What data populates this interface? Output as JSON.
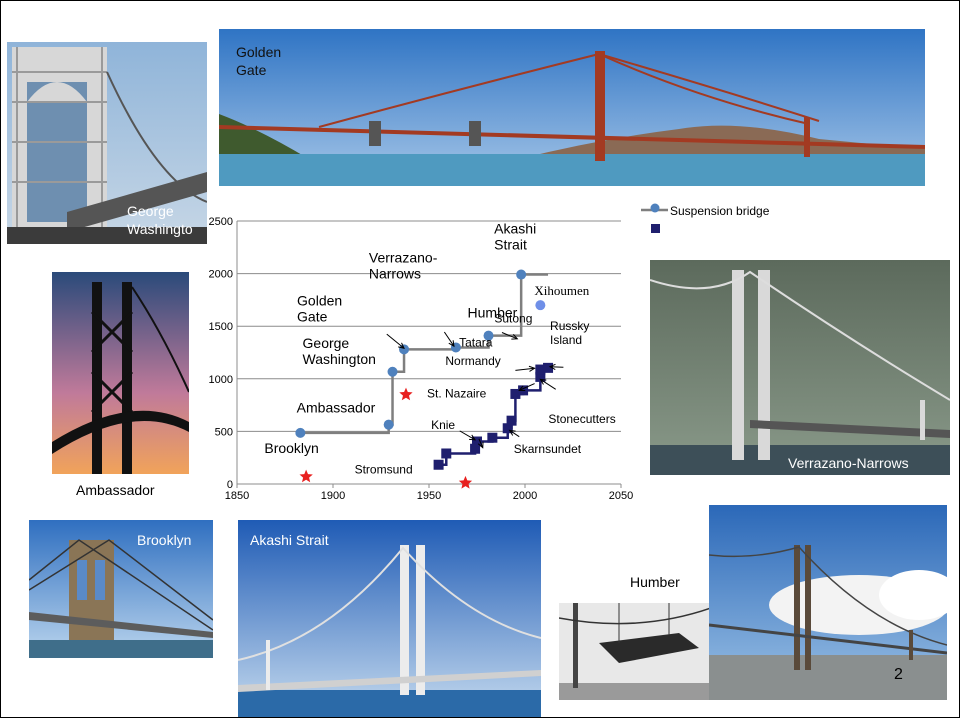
{
  "photos": {
    "george_washington": "George\nWashingto",
    "golden_gate": "Golden\nGate",
    "ambassador": "Ambassador",
    "verrazano": "Verrazano-Narrows",
    "brooklyn": "Brooklyn",
    "akashi": "Akashi Strait",
    "humber": "Humber"
  },
  "page_number": "2",
  "colors": {
    "suspension": "#4f81bd",
    "cable_stayed": "#1f1f6e",
    "line": "#7f7f7f",
    "star": "#e8201f"
  },
  "chart_data": {
    "type": "scatter",
    "xlim": [
      1850,
      2050
    ],
    "ylim": [
      0,
      2500
    ],
    "xticks": [
      1850,
      1900,
      1950,
      2000,
      2050
    ],
    "yticks": [
      0,
      500,
      1000,
      1500,
      2000,
      2500
    ],
    "grid": "horizontal",
    "legend_position": "top-right",
    "series": [
      {
        "name": "Suspension bridge",
        "marker": "circle",
        "points": [
          {
            "x": 1883,
            "y": 486,
            "label": "Brooklyn"
          },
          {
            "x": 1929,
            "y": 564,
            "label": "Ambassador"
          },
          {
            "x": 1931,
            "y": 1067,
            "label": "George\nWashington"
          },
          {
            "x": 1937,
            "y": 1280,
            "label": "Golden\nGate"
          },
          {
            "x": 1964,
            "y": 1298,
            "label": "Verrazano-\nNarrows"
          },
          {
            "x": 1981,
            "y": 1410,
            "label": "Humber"
          },
          {
            "x": 1998,
            "y": 1991,
            "label": "Akashi\nStrait"
          }
        ],
        "step_line": [
          [
            1883,
            486
          ],
          [
            1929,
            486
          ],
          [
            1929,
            564
          ],
          [
            1931,
            564
          ],
          [
            1931,
            1067
          ],
          [
            1937,
            1067
          ],
          [
            1937,
            1280
          ],
          [
            1964,
            1280
          ],
          [
            1964,
            1298
          ],
          [
            1981,
            1298
          ],
          [
            1981,
            1410
          ],
          [
            1998,
            1410
          ],
          [
            1998,
            1991
          ],
          [
            2012,
            1991
          ]
        ]
      },
      {
        "name": "",
        "marker": "square",
        "points": [
          {
            "x": 1955,
            "y": 183,
            "label": "Stromsund"
          },
          {
            "x": 1959,
            "y": 290
          },
          {
            "x": 1974,
            "y": 335,
            "label": "Knie"
          },
          {
            "x": 1975,
            "y": 404,
            "label": "St. Nazaire"
          },
          {
            "x": 1983,
            "y": 440
          },
          {
            "x": 1991,
            "y": 530,
            "label": "Skarnsundet"
          },
          {
            "x": 1993,
            "y": 602
          },
          {
            "x": 1995,
            "y": 856,
            "label": "Normandy"
          },
          {
            "x": 1999,
            "y": 890,
            "label": "Tatara"
          },
          {
            "x": 2008,
            "y": 1018,
            "label": "Stonecutters"
          },
          {
            "x": 2008,
            "y": 1088,
            "label": "Sutong"
          },
          {
            "x": 2012,
            "y": 1104,
            "label": "Russky\nIsland"
          }
        ],
        "step_line": [
          [
            1955,
            183
          ],
          [
            1959,
            183
          ],
          [
            1959,
            290
          ],
          [
            1974,
            290
          ],
          [
            1974,
            335
          ],
          [
            1975,
            335
          ],
          [
            1975,
            404
          ],
          [
            1983,
            404
          ],
          [
            1983,
            440
          ],
          [
            1991,
            440
          ],
          [
            1991,
            530
          ],
          [
            1993,
            530
          ],
          [
            1993,
            602
          ],
          [
            1995,
            602
          ],
          [
            1995,
            856
          ],
          [
            1999,
            856
          ],
          [
            1999,
            890
          ],
          [
            2008,
            890
          ],
          [
            2008,
            1088
          ],
          [
            2012,
            1088
          ],
          [
            2012,
            1104
          ]
        ]
      },
      {
        "name": "",
        "marker": "circle-light",
        "points": [
          {
            "x": 2008,
            "y": 1700,
            "label": "Xihoumen"
          }
        ]
      },
      {
        "name": "",
        "marker": "star",
        "points": [
          {
            "x": 1886,
            "y": 70
          },
          {
            "x": 1938,
            "y": 850
          },
          {
            "x": 1969,
            "y": 10
          }
        ]
      }
    ]
  }
}
